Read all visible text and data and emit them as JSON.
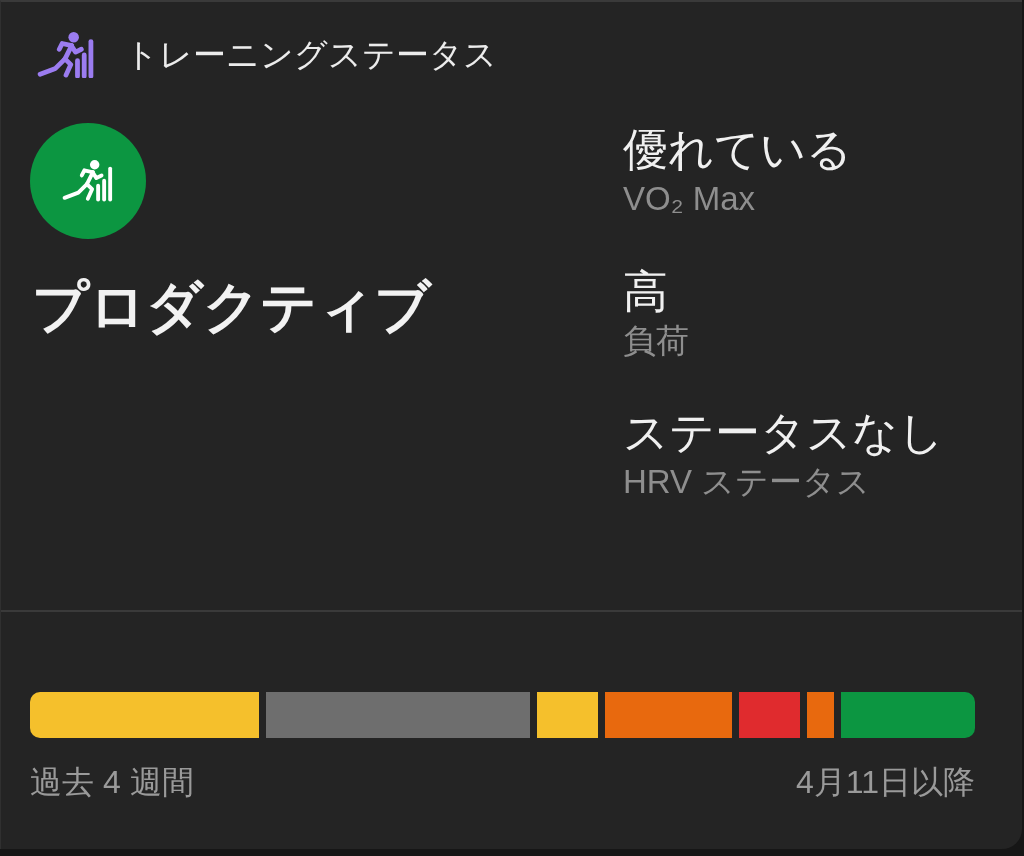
{
  "header": {
    "title": "トレーニングステータス"
  },
  "status": {
    "label": "プロダクティブ"
  },
  "metrics": [
    {
      "value": "優れている",
      "label": "VO₂ Max"
    },
    {
      "value": "高",
      "label": "負荷"
    },
    {
      "value": "ステータスなし",
      "label": "HRV ステータス"
    }
  ],
  "history": {
    "segments": [
      {
        "color": "#f5c02c"
      },
      {
        "color": "#6e6e6e"
      },
      {
        "color": "#f5c02c"
      },
      {
        "color": "#e8690e"
      },
      {
        "color": "#e02b2e"
      },
      {
        "color": "#e8690e"
      },
      {
        "color": "#0c9641"
      }
    ],
    "start_label": "過去 4 週間",
    "end_label": "4月11日以降"
  }
}
